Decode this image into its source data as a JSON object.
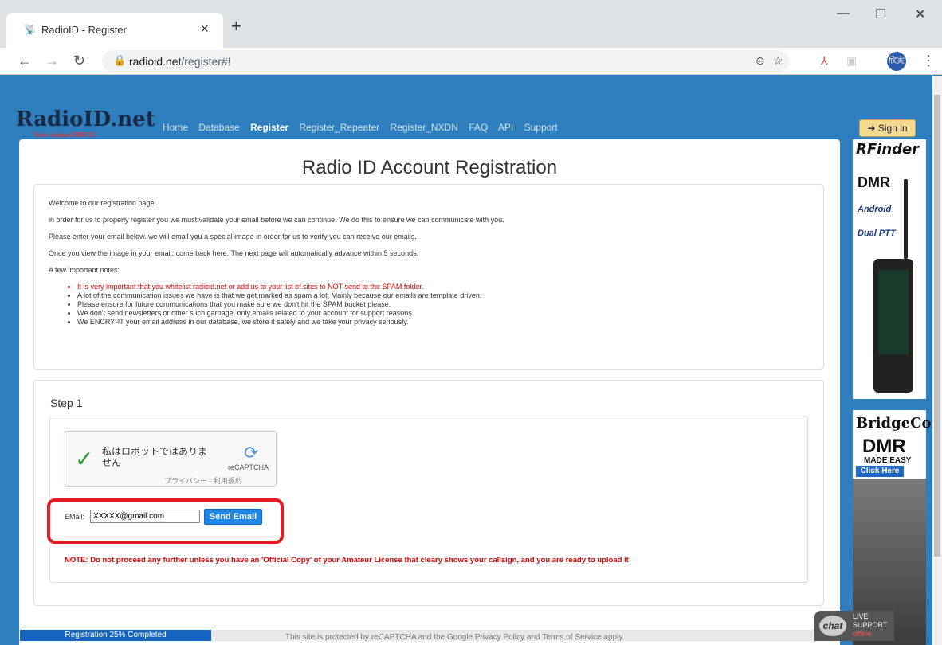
{
  "browser": {
    "tab_title": "RadioID - Register",
    "tab_close": "×",
    "new_tab": "+",
    "url_domain": "radioid.net",
    "url_path": "/register#!",
    "avatar": "欣実",
    "window": {
      "minimize": "—",
      "maximize": "☐",
      "close": "✕"
    }
  },
  "site": {
    "logo": "RadioID.net",
    "tagline": "Your unique DMR ID",
    "nav": [
      "Home",
      "Database",
      "Register",
      "Register_Repeater",
      "Register_NXDN",
      "FAQ",
      "API",
      "Support"
    ],
    "active_nav": "Register",
    "signin": "Sign in"
  },
  "main": {
    "title": "Radio ID Account Registration",
    "intro": [
      "Welcome to our registration page,",
      "in order for us to properly register you we must validate your email before we can continue. We do this to ensure we can communicate with you.",
      "Please enter your email below. we will email you a special image in order for us to verify you can receive our emails.",
      "Once you view the image in your email, come back here. The next page will automatically advance within 5 seconds.",
      "A few important notes:"
    ],
    "notes": [
      "It is very important that you whitelist radioid.net or add us to your list of sites to NOT send to the SPAM folder.",
      "A lot of the communication issues we have is that we get marked as spam a lot, Mainly because our emails are template driven.",
      "Please ensure for future communications that you make sure we don't hit the SPAM bucket please.",
      "We don't send newsletters or other such garbage, only emails related to your account for support reasons.",
      "We ENCRYPT your email address in our database, we store it safely and we take your privacy seriously."
    ],
    "step_label": "Step 1",
    "captcha": {
      "text": "私はロボットではありません",
      "brand": "reCAPTCHA",
      "links": "プライバシー - 利用規約"
    },
    "email_label": "EMail:",
    "email_value": "XXXXX@gmail.com",
    "send_button": "Send Email",
    "warning": "NOTE: Do not proceed any further unless you have an 'Official Copy' of your Amateur License that cleary shows your callsign, and you are ready to upload it"
  },
  "footer": {
    "progress": "Registration 25% Completed",
    "progress_fraction": 0.25,
    "recaptcha_notice": "This site is protected by reCAPTCHA and the Google Privacy Policy and Terms of Service apply."
  },
  "ads": {
    "rfinder": {
      "brand": "RFinder",
      "line1": "DMR",
      "line2": "Android",
      "line3": "Dual PTT"
    },
    "bridgecom": {
      "brand": "BridgeCom",
      "line1": "DMR",
      "line2": "MADE EASY",
      "cta": "Click Here"
    }
  },
  "chat": {
    "bubble": "chat",
    "line1": "LIVE",
    "line2": "SUPPORT",
    "line3": "offline"
  },
  "colors": {
    "page_bg": "#2f7fbf",
    "warning_red": "#d00",
    "button_blue": "#1e88e5",
    "highlight_red": "#e31b23"
  }
}
